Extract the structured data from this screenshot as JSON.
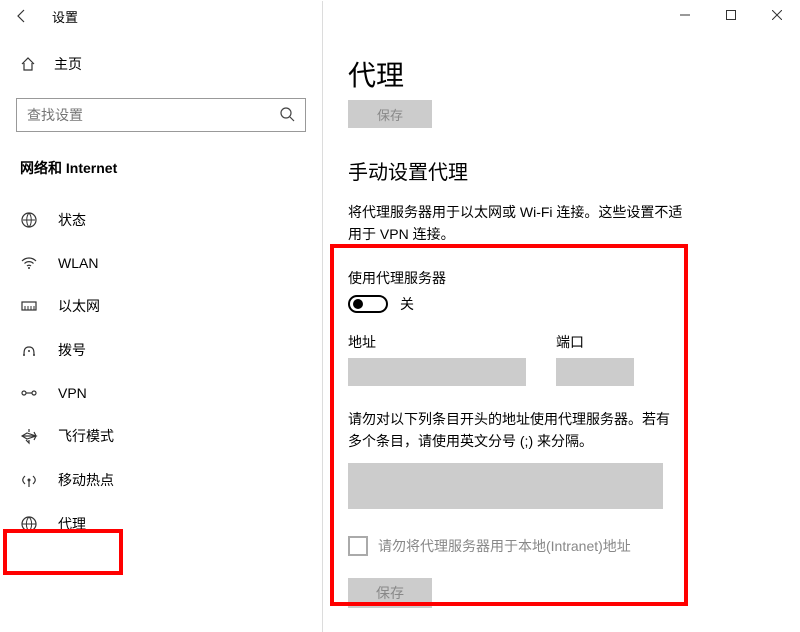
{
  "window": {
    "title": "设置"
  },
  "sidebar": {
    "home_label": "主页",
    "search_placeholder": "查找设置",
    "section_label": "网络和 Internet",
    "items": [
      {
        "label": "状态",
        "selected": false
      },
      {
        "label": "WLAN",
        "selected": false
      },
      {
        "label": "以太网",
        "selected": false
      },
      {
        "label": "拨号",
        "selected": false
      },
      {
        "label": "VPN",
        "selected": false
      },
      {
        "label": "飞行模式",
        "selected": false
      },
      {
        "label": "移动热点",
        "selected": false
      },
      {
        "label": "代理",
        "selected": true
      }
    ]
  },
  "content": {
    "page_title": "代理",
    "top_save_label": "保存",
    "section_title": "手动设置代理",
    "section_desc": "将代理服务器用于以太网或 Wi-Fi 连接。这些设置不适用于 VPN 连接。",
    "use_proxy_label": "使用代理服务器",
    "toggle_state": "关",
    "address_label": "地址",
    "address_value": "",
    "port_label": "端口",
    "port_value": "",
    "bypass_desc": "请勿对以下列条目开头的地址使用代理服务器。若有多个条目，请使用英文分号 (;) 来分隔。",
    "bypass_value": "",
    "local_bypass_label": "请勿将代理服务器用于本地(Intranet)地址",
    "save_label": "保存"
  }
}
